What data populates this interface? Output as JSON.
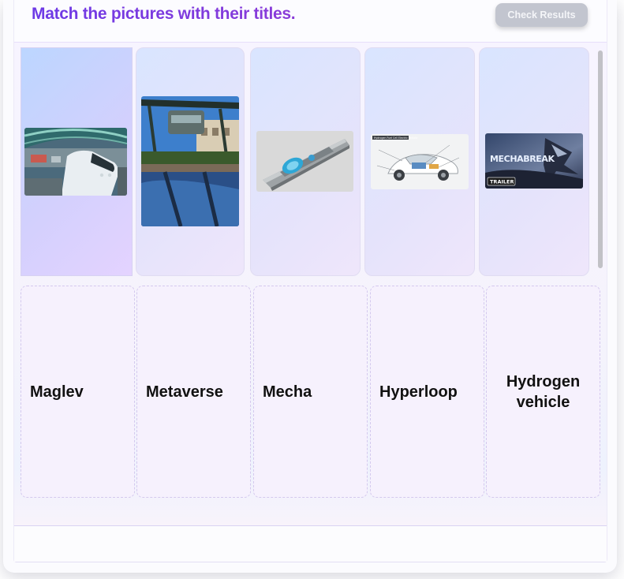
{
  "header": {
    "title": "Match the pictures with their titles.",
    "check_button": "Check Results"
  },
  "images": [
    {
      "icon": "maglev-train-photo"
    },
    {
      "icon": "suspended-monorail-photo"
    },
    {
      "icon": "hyperloop-tube-render"
    },
    {
      "icon": "hydrogen-car-diagram",
      "caption": "Hydrogen Fuel Cell Electric Vehicle"
    },
    {
      "icon": "mecha-game-poster",
      "logo_text": "MECHABREAK",
      "badge": "TRAILER"
    }
  ],
  "titles": [
    "Maglev",
    "Metaverse",
    "Mecha",
    "Hyperloop",
    "Hydrogen vehicle"
  ],
  "colors": {
    "title_gradient": [
      "#6d3ae6",
      "#8a3bd8"
    ],
    "button_disabled": "#c2c5cf",
    "dropzone_border": "#d4c9ee",
    "card_bg": "#e5e3fb"
  }
}
